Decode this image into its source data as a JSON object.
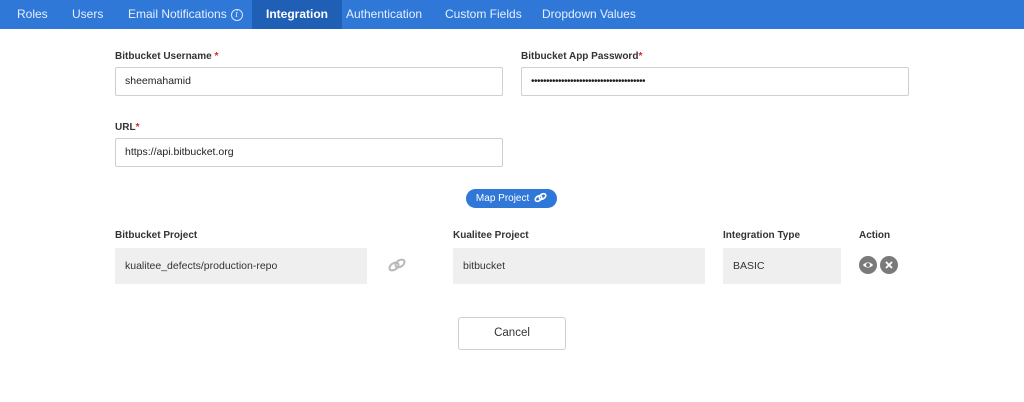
{
  "nav": {
    "tabs": [
      {
        "label": "Roles"
      },
      {
        "label": "Users"
      },
      {
        "label": "Email Notifications"
      },
      {
        "label": "Integration"
      },
      {
        "label": "Authentication"
      },
      {
        "label": "Custom Fields"
      },
      {
        "label": "Dropdown Values"
      }
    ],
    "active_tab": "Integration",
    "info_glyph": "i"
  },
  "form": {
    "username": {
      "label": "Bitbucket Username",
      "required_mark": "*",
      "value": "sheemahamid"
    },
    "password": {
      "label": "Bitbucket App Password",
      "required_mark": "*",
      "value": "••••••••••••••••••••••••••••••••••••••"
    },
    "url": {
      "label": "URL",
      "required_mark": "*",
      "value": "https://api.bitbucket.org"
    }
  },
  "map_project_label": "Map Project",
  "mapping_table": {
    "headers": {
      "bitbucket_project": "Bitbucket Project",
      "kualitee_project": "Kualitee Project",
      "integration_type": "Integration Type",
      "action": "Action"
    },
    "row": {
      "bitbucket_project": "kualitee_defects/production-repo",
      "kualitee_project": "bitbucket",
      "integration_type": "BASIC"
    }
  },
  "cancel_label": "Cancel",
  "colors": {
    "accent": "#2f78d8",
    "active_tab": "#1f5fb5",
    "required": "#e0251b",
    "action_icon_bg": "#7a7a7a"
  }
}
